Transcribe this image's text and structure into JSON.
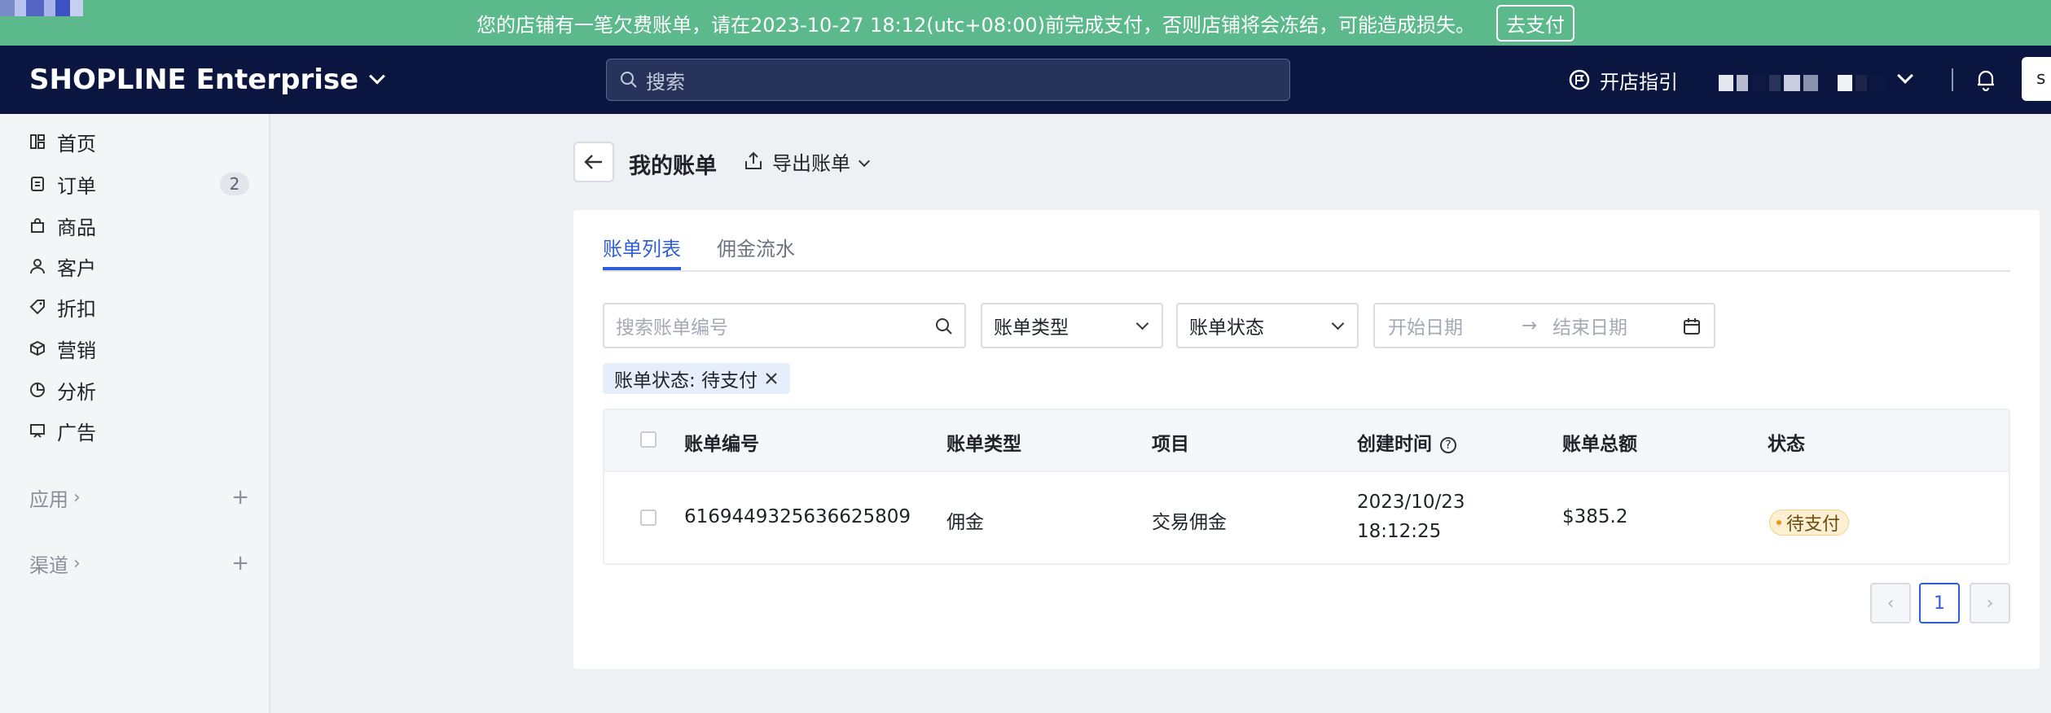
{
  "banner": {
    "message": "您的店铺有一笔欠费账单，请在2023-10-27 18:12(utc+08:00)前完成支付，否则店铺将会冻结，可能造成损失。",
    "pay_label": "去支付"
  },
  "topbar": {
    "brand": "SHOPLINE Enterprise",
    "search_placeholder": "搜索",
    "guide_label": "开店指引",
    "corner_label": "s"
  },
  "sidebar": {
    "items": [
      {
        "label": "首页",
        "icon": "dashboard-icon"
      },
      {
        "label": "订单",
        "icon": "order-icon",
        "badge": "2"
      },
      {
        "label": "商品",
        "icon": "bag-icon"
      },
      {
        "label": "客户",
        "icon": "user-icon"
      },
      {
        "label": "折扣",
        "icon": "tag-icon"
      },
      {
        "label": "营销",
        "icon": "cube-icon"
      },
      {
        "label": "分析",
        "icon": "pie-icon"
      },
      {
        "label": "广告",
        "icon": "ad-icon"
      }
    ],
    "groups": [
      {
        "label": "应用",
        "arrow": "›",
        "plus": "+"
      },
      {
        "label": "渠道",
        "arrow": "›",
        "plus": "+"
      }
    ]
  },
  "header": {
    "title": "我的账单",
    "export_label": "导出账单"
  },
  "tabs": [
    {
      "label": "账单列表",
      "active": true
    },
    {
      "label": "佣金流水",
      "active": false
    }
  ],
  "filters": {
    "search_placeholder": "搜索账单编号",
    "type_label": "账单类型",
    "status_label": "账单状态",
    "start_placeholder": "开始日期",
    "end_placeholder": "结束日期",
    "date_arrow": "→",
    "chip_label": "账单状态: 待支付"
  },
  "table": {
    "columns": [
      "账单编号",
      "账单类型",
      "项目",
      "创建时间",
      "账单总额",
      "状态"
    ],
    "help_glyph": "?",
    "rows": [
      {
        "id": "6169449325636625809",
        "type": "佣金",
        "item": "交易佣金",
        "created_date": "2023/10/23",
        "created_time": "18:12:25",
        "amount": "$385.2",
        "status": "待支付"
      }
    ]
  },
  "pagination": {
    "prev": "‹",
    "current": "1",
    "next": "›"
  },
  "colors": {
    "banner": "#5bb98b",
    "topbar": "#0b1640",
    "accent": "#2f5fd6",
    "pending_badge": "#fdf0d2"
  }
}
